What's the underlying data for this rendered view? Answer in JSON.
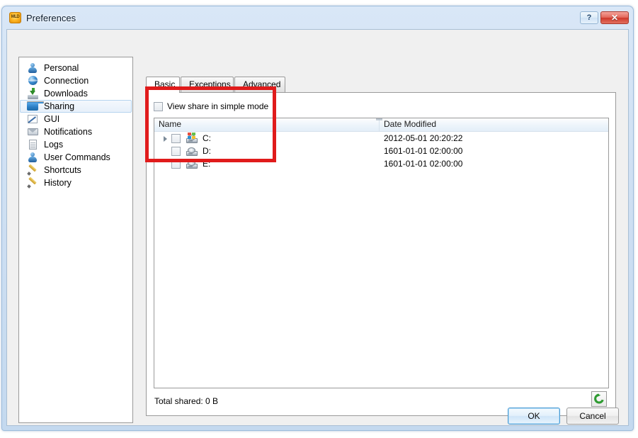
{
  "window": {
    "title": "Preferences",
    "icon": "mldonkey-logo-icon",
    "help_label": "?",
    "close_label": "✕"
  },
  "sidebar": {
    "items": [
      {
        "label": "Personal",
        "icon": "person-icon",
        "selected": false
      },
      {
        "label": "Connection",
        "icon": "globe-icon",
        "selected": false
      },
      {
        "label": "Downloads",
        "icon": "download-icon",
        "selected": false
      },
      {
        "label": "Sharing",
        "icon": "folder-icon",
        "selected": true
      },
      {
        "label": "GUI",
        "icon": "chart-icon",
        "selected": false
      },
      {
        "label": "Notifications",
        "icon": "envelope-icon",
        "selected": false
      },
      {
        "label": "Logs",
        "icon": "document-icon",
        "selected": false
      },
      {
        "label": "User Commands",
        "icon": "person-icon",
        "selected": false
      },
      {
        "label": "Shortcuts",
        "icon": "pencil-icon",
        "selected": false
      },
      {
        "label": "History",
        "icon": "pencil-icon",
        "selected": false
      }
    ]
  },
  "tabs": [
    {
      "label": "Basic",
      "active": true
    },
    {
      "label": "Exceptions",
      "active": false
    },
    {
      "label": "Advanced",
      "active": false
    }
  ],
  "panel": {
    "simple_mode": {
      "label": "View share in simple mode",
      "checked": false
    },
    "columns": [
      {
        "key": "name",
        "label": "Name"
      },
      {
        "key": "date",
        "label": "Date Modified"
      }
    ],
    "rows": [
      {
        "name": "C:",
        "date": "2012-05-01 20:20:22",
        "checked": false,
        "expandable": true,
        "icon": "windows-drive-icon"
      },
      {
        "name": "D:",
        "date": "1601-01-01 02:00:00",
        "checked": false,
        "expandable": false,
        "icon": "drive-icon"
      },
      {
        "name": "E:",
        "date": "1601-01-01 02:00:00",
        "checked": false,
        "expandable": false,
        "icon": "drive-icon"
      }
    ],
    "total_shared": "Total shared: 0 B",
    "refresh_icon": "refresh-icon"
  },
  "footer": {
    "ok_label": "OK",
    "cancel_label": "Cancel"
  },
  "colors": {
    "annotation": "#e01b1b",
    "title_bar": "#cfe0f3",
    "selection": "#e7f0fa",
    "accent_button": "#4a9ad4",
    "refresh_green": "#2f9b32",
    "close_red": "#cf392c"
  }
}
